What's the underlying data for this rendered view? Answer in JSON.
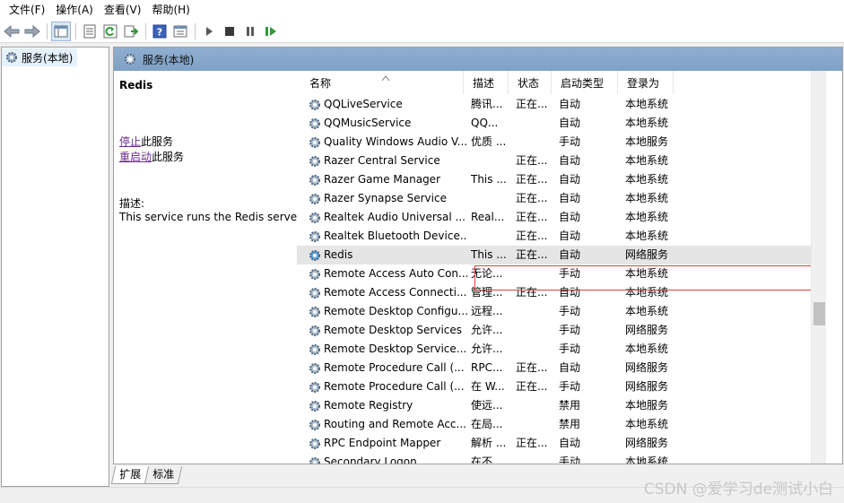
{
  "menu": [
    "文件(F)",
    "操作(A)",
    "查看(V)",
    "帮助(H)"
  ],
  "toolbar": {
    "icons": [
      "back-arrow-icon",
      "forward-arrow-icon",
      "console-tree-icon",
      "properties-icon",
      "refresh-icon",
      "export-icon",
      "help-icon",
      "view-icon",
      "start-icon",
      "stop-icon",
      "pause-icon",
      "restart-icon"
    ]
  },
  "tree": {
    "item_label": "服务(本地)"
  },
  "panel": {
    "header_title": "服务(本地)"
  },
  "detail": {
    "service_name": "Redis",
    "stop_link": "停止",
    "stop_suffix": "此服务",
    "restart_link": "重启动",
    "restart_suffix": "此服务",
    "desc_label": "描述:",
    "desc_text": "This service runs the Redis server"
  },
  "columns": {
    "name": "名称",
    "desc": "描述",
    "status": "状态",
    "startup": "启动类型",
    "logon": "登录为"
  },
  "rows": [
    {
      "name": "QQLiveService",
      "desc": "腾讯...",
      "status": "正在...",
      "startup": "自动",
      "logon": "本地系统"
    },
    {
      "name": "QQMusicService",
      "desc": "QQ...",
      "status": "",
      "startup": "自动",
      "logon": "本地系统"
    },
    {
      "name": "Quality Windows Audio V...",
      "desc": "优质 ...",
      "status": "",
      "startup": "手动",
      "logon": "本地服务"
    },
    {
      "name": "Razer Central Service",
      "desc": "",
      "status": "正在...",
      "startup": "自动",
      "logon": "本地系统"
    },
    {
      "name": "Razer Game Manager",
      "desc": "This ...",
      "status": "正在...",
      "startup": "自动",
      "logon": "本地系统"
    },
    {
      "name": "Razer Synapse Service",
      "desc": "",
      "status": "正在...",
      "startup": "自动",
      "logon": "本地系统"
    },
    {
      "name": "Realtek Audio Universal ...",
      "desc": "Real...",
      "status": "正在...",
      "startup": "自动",
      "logon": "本地系统"
    },
    {
      "name": "Realtek Bluetooth Device...",
      "desc": "",
      "status": "正在...",
      "startup": "自动",
      "logon": "本地系统"
    },
    {
      "name": "Redis",
      "desc": "This ...",
      "status": "正在...",
      "startup": "自动",
      "logon": "网络服务"
    },
    {
      "name": "Remote Access Auto Con...",
      "desc": "无论...",
      "status": "",
      "startup": "手动",
      "logon": "本地系统"
    },
    {
      "name": "Remote Access Connecti...",
      "desc": "管理...",
      "status": "正在...",
      "startup": "自动",
      "logon": "本地系统"
    },
    {
      "name": "Remote Desktop Configu...",
      "desc": "远程...",
      "status": "",
      "startup": "手动",
      "logon": "本地系统"
    },
    {
      "name": "Remote Desktop Services",
      "desc": "允许...",
      "status": "",
      "startup": "手动",
      "logon": "网络服务"
    },
    {
      "name": "Remote Desktop Service...",
      "desc": "允许...",
      "status": "",
      "startup": "手动",
      "logon": "本地系统"
    },
    {
      "name": "Remote Procedure Call (...",
      "desc": "RPC...",
      "status": "正在...",
      "startup": "自动",
      "logon": "网络服务"
    },
    {
      "name": "Remote Procedure Call (...",
      "desc": "在 W...",
      "status": "正在...",
      "startup": "手动",
      "logon": "网络服务"
    },
    {
      "name": "Remote Registry",
      "desc": "使远...",
      "status": "",
      "startup": "禁用",
      "logon": "本地服务"
    },
    {
      "name": "Routing and Remote Acc...",
      "desc": "在局...",
      "status": "",
      "startup": "禁用",
      "logon": "本地系统"
    },
    {
      "name": "RPC Endpoint Mapper",
      "desc": "解析 ...",
      "status": "正在...",
      "startup": "自动",
      "logon": "网络服务"
    },
    {
      "name": "Secondary Logon",
      "desc": "在不...",
      "status": "",
      "startup": "手动",
      "logon": "本地系统"
    }
  ],
  "selected_row": "Redis",
  "tabs": [
    "扩展",
    "标准"
  ],
  "watermark": "CSDN @爱学习de测试小白"
}
